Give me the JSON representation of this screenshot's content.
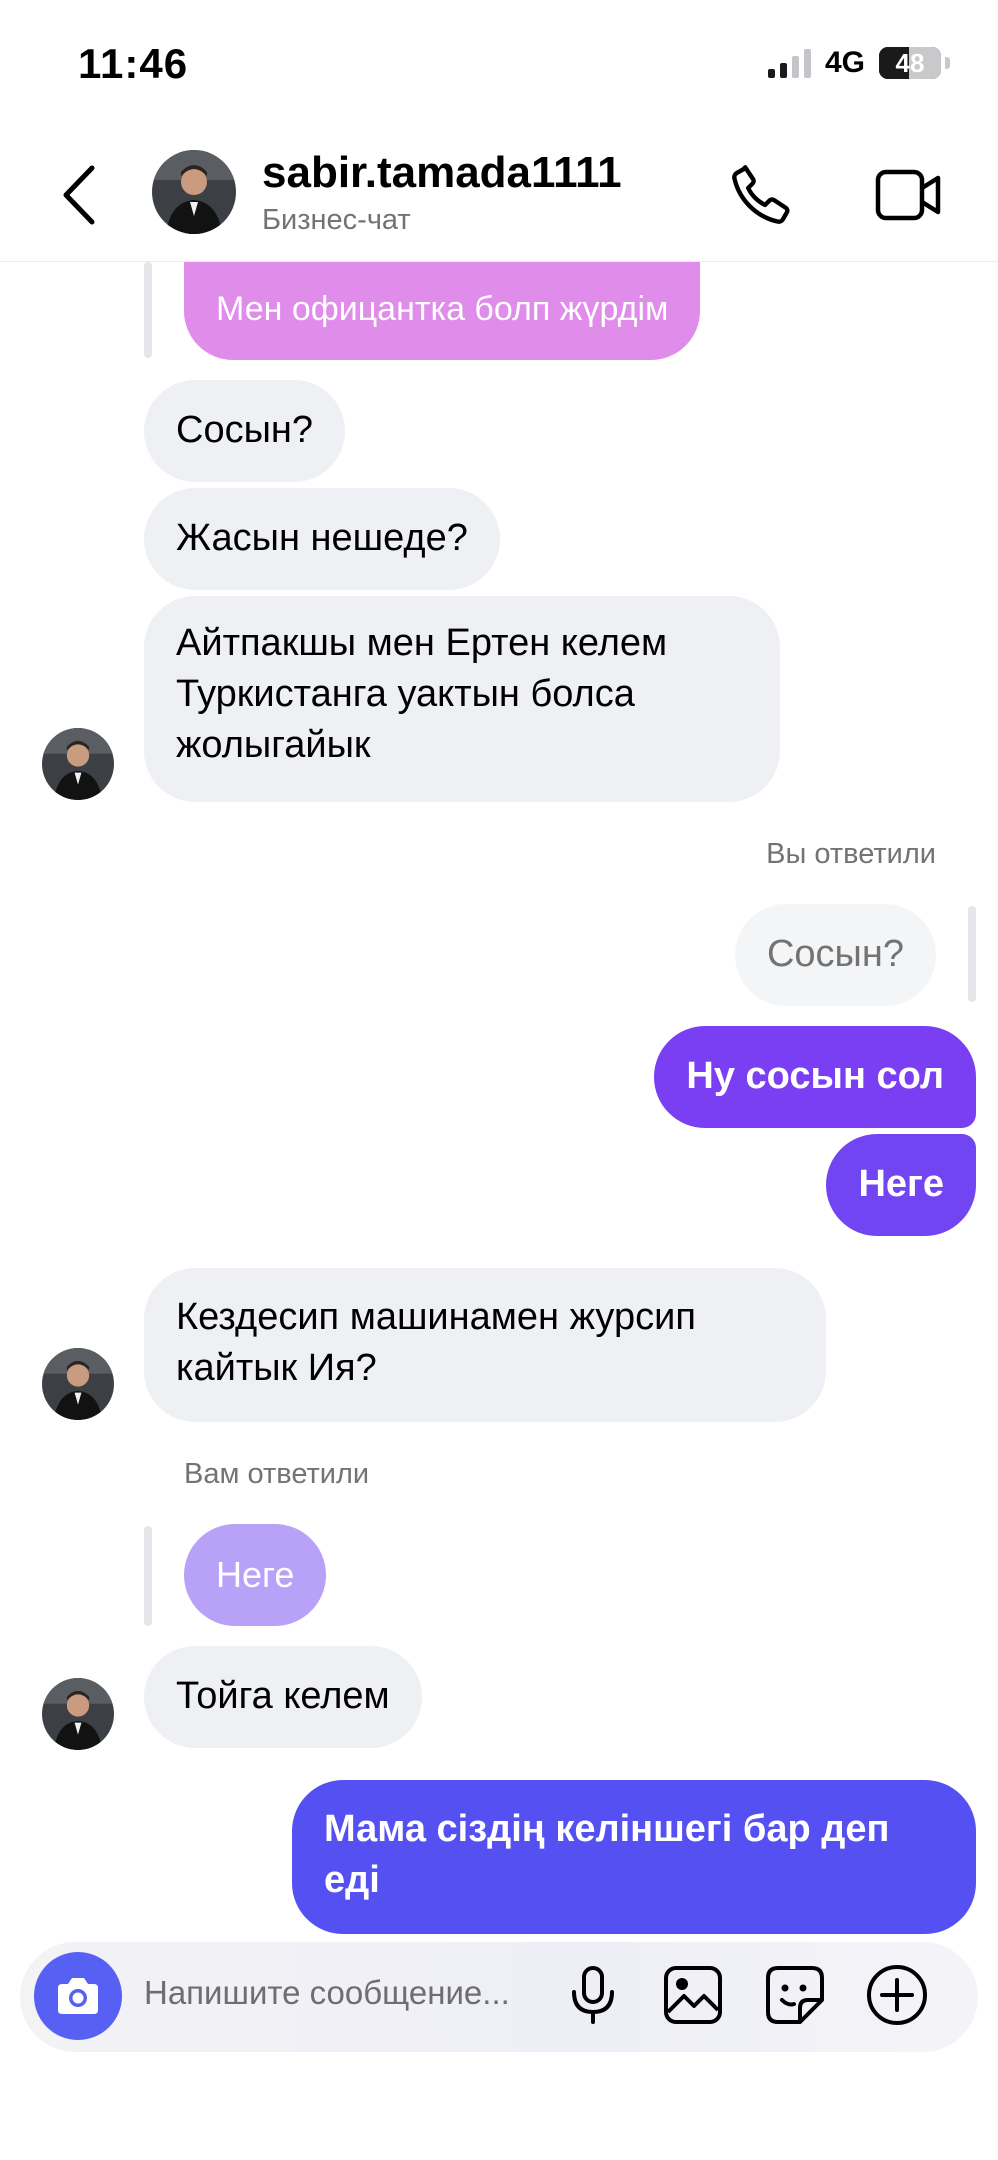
{
  "status_bar": {
    "time": "11:46",
    "network": "4G",
    "battery": "48"
  },
  "header": {
    "username": "sabir.tamada1111",
    "subtitle": "Бизнес-чат",
    "icons": [
      "back-icon",
      "phone-icon",
      "video-camera-icon"
    ]
  },
  "messages": [
    {
      "side": "in",
      "kind": "replied-quote",
      "text": "Мен офицантка болп жүрдім"
    },
    {
      "side": "in",
      "text": "Сосын?"
    },
    {
      "side": "in",
      "text": "Жасын нешеде?"
    },
    {
      "side": "in",
      "text": "Айтпакшы мен Ертен келем Туркистанга уактын болса жолыгайык"
    },
    {
      "side": "out",
      "kind": "reply-label",
      "text": "Вы ответили"
    },
    {
      "side": "out",
      "kind": "replied-quote",
      "text": "Сосын?"
    },
    {
      "side": "out",
      "text": "Ну сосын сол"
    },
    {
      "side": "out",
      "text": "Неге"
    },
    {
      "side": "in",
      "text": "Кездесип машинамен журсип кайтык Ия?"
    },
    {
      "side": "in",
      "kind": "reply-label",
      "text": "Вам ответили"
    },
    {
      "side": "in",
      "kind": "replied-quote",
      "text": "Неге"
    },
    {
      "side": "in",
      "text": "Тойга келем"
    },
    {
      "side": "out",
      "text": "Мама сіздің келіншегі бар деп еді"
    }
  ],
  "composer": {
    "placeholder": "Напишите сообщение...",
    "icons": [
      "camera-icon",
      "microphone-icon",
      "gallery-icon",
      "sticker-icon",
      "add-icon"
    ]
  },
  "colors": {
    "accent": "#5a5cf3",
    "outgoing_top": "#7b3ff2",
    "outgoing_bottom": "#5550f2",
    "incoming": "#eef0f3",
    "quote_pink": "#de86ea",
    "quote_lilac": "#b7a2f8"
  }
}
